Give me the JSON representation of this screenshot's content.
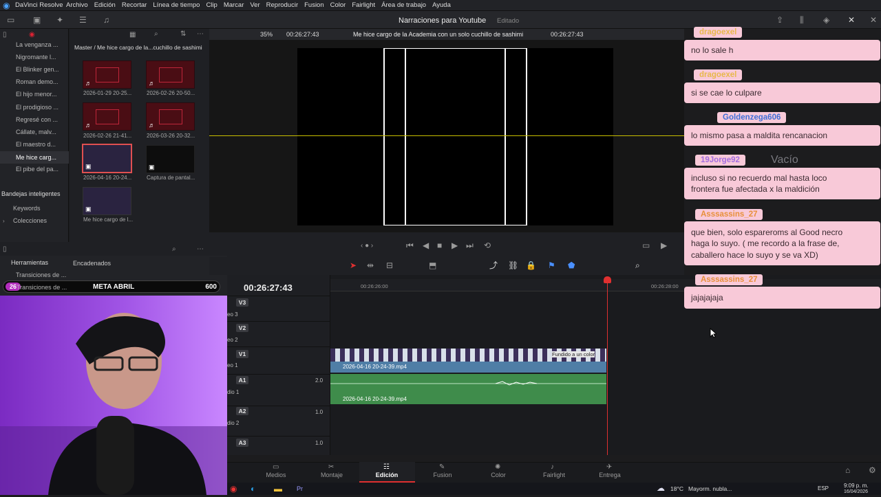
{
  "app": {
    "name": "DaVinci Resolve",
    "menu": [
      "Archivo",
      "Edición",
      "Recortar",
      "Línea de tiempo",
      "Clip",
      "Marcar",
      "Ver",
      "Reproducir",
      "Fusion",
      "Color",
      "Fairlight",
      "Área de trabajo",
      "Ayuda"
    ],
    "project_title": "Narraciones para Youtube",
    "project_status": "Editado"
  },
  "media_pool": {
    "bins": [
      "La venganza ...",
      "Nigromante l...",
      "El Blinker gen...",
      "Roman demo...",
      "El hijo menor...",
      "El prodigioso ...",
      "Regresé con ...",
      "Cállate, malv...",
      "El maestro d...",
      "Me hice carg...",
      "El pibe del pa..."
    ],
    "path": "Master / Me hice cargo de la...cuchillo de sashimi",
    "clips": [
      "2026-01-29 20-25...",
      "2026-02-26 20-50...",
      "2026-02-26 21-41...",
      "2026-03-26 20-32...",
      "2026-04-16 20-24...",
      "Captura de pantal...",
      "Me hice cargo de l..."
    ],
    "smart_bins": "Bandejas inteligentes",
    "smart_items": [
      "Keywords",
      "Colecciones"
    ],
    "effects_title": "Herramientas",
    "effects_item": "Transiciones de ...",
    "effects_item2": "Transiciones de ...",
    "chained": "Encadenados"
  },
  "viewer": {
    "zoom": "35%",
    "timecode_left": "00:26:27:43",
    "timeline_name": "Me hice cargo de la Academia con un solo cuchillo de sashimi",
    "timecode_right": "00:26:27:43"
  },
  "timeline": {
    "timecode": "00:26:27:43",
    "ruler": [
      "00:26:26:00",
      "00:26:28:00"
    ],
    "tracks": [
      {
        "id": "V3",
        "label": "eo 3"
      },
      {
        "id": "V2",
        "label": "eo 2"
      },
      {
        "id": "V1",
        "label": "eo 1"
      },
      {
        "id": "A1",
        "label": "dio 1",
        "level": "2.0"
      },
      {
        "id": "A2",
        "label": "dio 2",
        "level": "1.0"
      },
      {
        "id": "A3",
        "label": "",
        "level": "1.0"
      }
    ],
    "video_clip": "2026-04-16 20-24-39.mp4",
    "audio_clip": "2026-04-16 20-24-39.mp4",
    "clip_overlay": "Fundido a un color"
  },
  "overlay": {
    "meta_num": "26",
    "meta_label": "META ABRIL",
    "meta_value": "600"
  },
  "pages": [
    "Medios",
    "Montaje",
    "Edición",
    "Fusion",
    "Color",
    "Fairlight",
    "Entrega"
  ],
  "active_page": "Edición",
  "taskbar": {
    "weather": "18°C",
    "weather_text": "Mayorm. nubla...",
    "lang": "ESP",
    "time": "9:09 p. m.",
    "date": "16/04/2026"
  },
  "chat": {
    "empty_label": "Vacío",
    "messages": [
      {
        "user": "dragoexel",
        "text": [
          "no lo sale h"
        ]
      },
      {
        "user": "dragoexel",
        "text": [
          "si se cae lo culpare"
        ]
      },
      {
        "user": "Goldenzega606",
        "text": [
          "lo mismo pasa a maldita rencanacion"
        ]
      },
      {
        "user": "19Jorge92",
        "text": [
          "incluso si no recuerdo mal hasta loco",
          "frontera fue afectada x la maldición"
        ]
      },
      {
        "user": "Asssassins_27",
        "text": [
          "que bien, solo espareroms al Good necro",
          "haga lo suyo. ( me recordo a la frase de,",
          "caballero hace lo suyo y se va XD)"
        ]
      },
      {
        "user": "Asssassins_27",
        "text": [
          "jajajajaja"
        ]
      }
    ]
  }
}
